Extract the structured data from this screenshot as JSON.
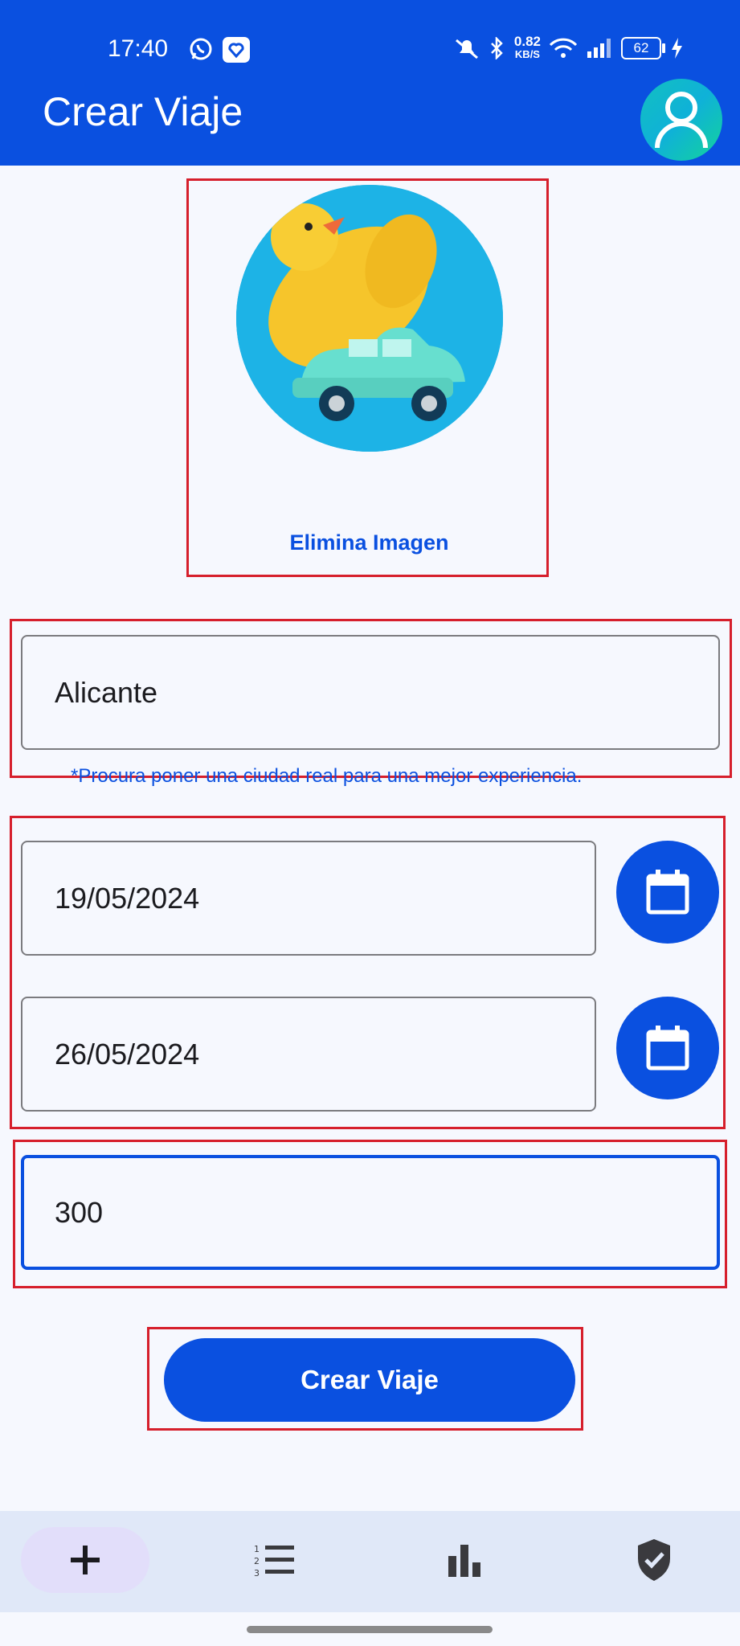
{
  "status_bar": {
    "time": "17:40",
    "net_speed_value": "0.82",
    "net_speed_unit": "KB/S",
    "battery": "62",
    "icons": [
      "whatsapp-icon",
      "app-notification-icon",
      "mute-icon",
      "bluetooth-icon",
      "wifi-icon",
      "signal-icon",
      "battery-icon",
      "charging-icon"
    ]
  },
  "app_bar": {
    "title": "Crear Viaje",
    "avatar_icon": "user-icon"
  },
  "image_section": {
    "image_description": "rubber-duck-on-toy-car",
    "remove_label": "Elimina Imagen"
  },
  "form": {
    "city_value": "Alicante",
    "city_helper": "*Procura poner una ciudad real para una mejor experiencia.",
    "start_date": "19/05/2024",
    "end_date": "26/05/2024",
    "budget_value": "300",
    "submit_label": "Crear Viaje"
  },
  "bottom_nav": {
    "items": [
      {
        "name": "add",
        "icon": "plus-icon",
        "active": true
      },
      {
        "name": "list",
        "icon": "numbered-list-icon",
        "active": false
      },
      {
        "name": "stats",
        "icon": "bar-chart-icon",
        "active": false
      },
      {
        "name": "verified",
        "icon": "shield-check-icon",
        "active": false
      }
    ]
  },
  "colors": {
    "primary": "#0a50e0",
    "background": "#f6f8fe",
    "annotation_red": "#d61f2c",
    "nav_background": "#e0e8f8",
    "nav_active": "#e2defa"
  }
}
